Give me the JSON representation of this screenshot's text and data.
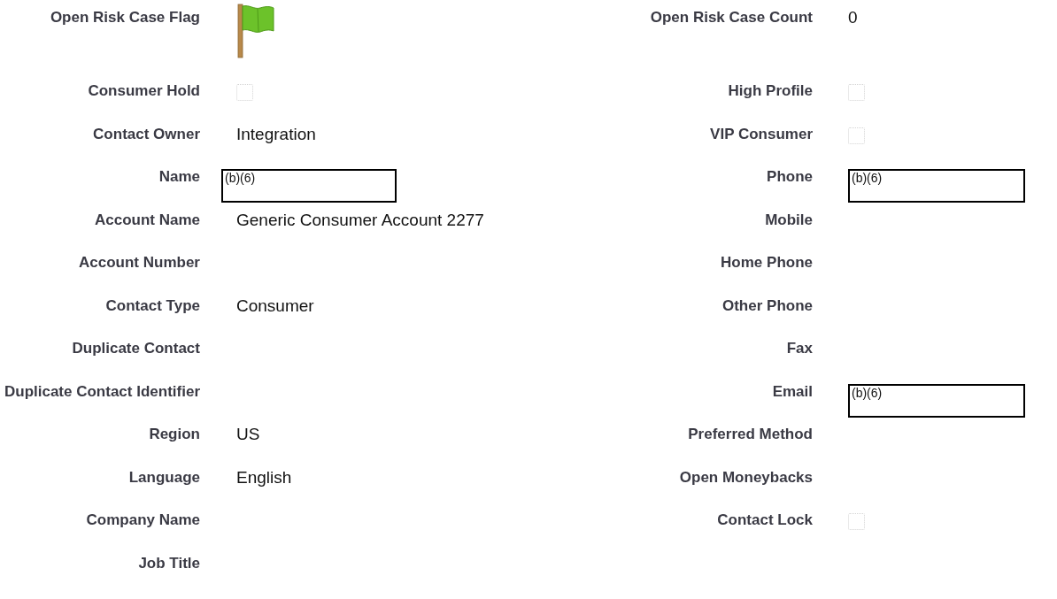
{
  "rows": [
    {
      "left": {
        "label": "Open Risk Case Flag",
        "kind": "flag"
      },
      "right": {
        "label": "Open Risk Case Count",
        "kind": "text",
        "value": "0"
      }
    },
    {
      "left": {
        "label": "Consumer Hold",
        "kind": "checkbox",
        "checked": false
      },
      "right": {
        "label": "High Profile",
        "kind": "checkbox",
        "checked": false
      }
    },
    {
      "left": {
        "label": "Contact Owner",
        "kind": "text",
        "value": "Integration"
      },
      "right": {
        "label": "VIP Consumer",
        "kind": "checkbox",
        "checked": false
      }
    },
    {
      "left": {
        "label": "Name",
        "kind": "redacted",
        "value": "(b)(6)"
      },
      "right": {
        "label": "Phone",
        "kind": "redacted",
        "value": "(b)(6)"
      }
    },
    {
      "left": {
        "label": "Account Name",
        "kind": "text",
        "value": "Generic Consumer Account 2277"
      },
      "right": {
        "label": "Mobile",
        "kind": "empty"
      }
    },
    {
      "left": {
        "label": "Account Number",
        "kind": "empty"
      },
      "right": {
        "label": "Home Phone",
        "kind": "empty"
      }
    },
    {
      "left": {
        "label": "Contact Type",
        "kind": "text",
        "value": "Consumer"
      },
      "right": {
        "label": "Other Phone",
        "kind": "empty"
      }
    },
    {
      "left": {
        "label": "Duplicate Contact",
        "kind": "empty"
      },
      "right": {
        "label": "Fax",
        "kind": "empty"
      }
    },
    {
      "left": {
        "label": "Duplicate Contact Identifier",
        "kind": "empty"
      },
      "right": {
        "label": "Email",
        "kind": "redacted",
        "value": "(b)(6)"
      }
    },
    {
      "left": {
        "label": "Region",
        "kind": "text",
        "value": "US"
      },
      "right": {
        "label": "Preferred Method",
        "kind": "empty"
      }
    },
    {
      "left": {
        "label": "Language",
        "kind": "text",
        "value": "English"
      },
      "right": {
        "label": "Open Moneybacks",
        "kind": "empty"
      }
    },
    {
      "left": {
        "label": "Company Name",
        "kind": "empty"
      },
      "right": {
        "label": "Contact Lock",
        "kind": "checkbox",
        "checked": false
      }
    },
    {
      "left": {
        "label": "Job Title",
        "kind": "empty"
      }
    }
  ]
}
